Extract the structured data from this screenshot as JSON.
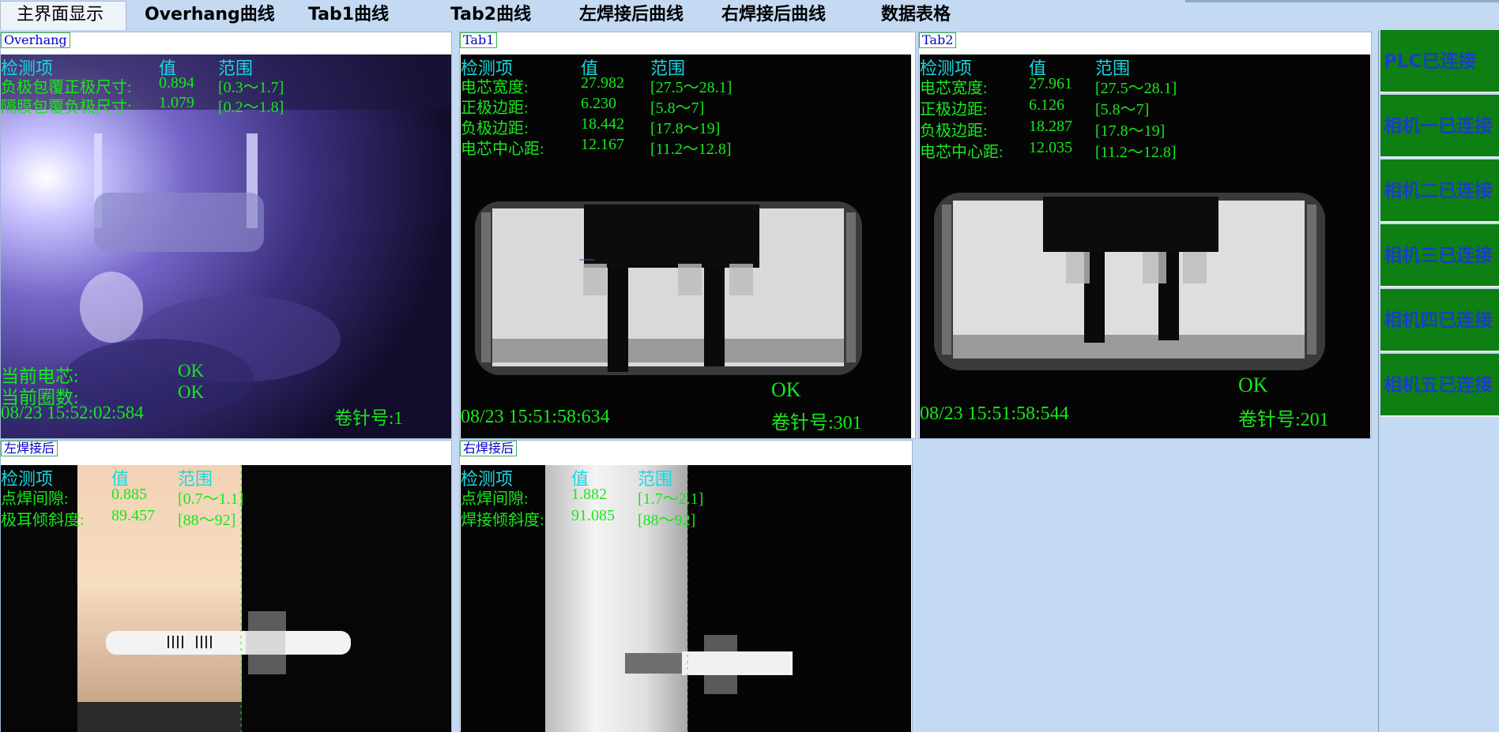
{
  "tabs": [
    {
      "label": "主界面显示"
    },
    {
      "label": "Overhang曲线"
    },
    {
      "label": "Tab1曲线"
    },
    {
      "label": "Tab2曲线"
    },
    {
      "label": "左焊接后曲线"
    },
    {
      "label": "右焊接后曲线"
    },
    {
      "label": "数据表格"
    }
  ],
  "panels": {
    "overhang": {
      "label": "Overhang",
      "header": {
        "item": "检测项",
        "value": "值",
        "range": "范围"
      },
      "rows": [
        {
          "name": "负极包覆正极尺寸:",
          "value": "0.894",
          "range": "[0.3～1.7]"
        },
        {
          "name": "隔膜包覆负极尺寸:",
          "value": "1.079",
          "range": "[0.2～1.8]"
        }
      ],
      "current_cell_label": "当前电芯:",
      "current_cell_value": "OK",
      "current_turns_label": "当前圈数:",
      "current_turns_value": "OK",
      "timestamp": "08/23 15:52:02:584",
      "pin": "卷针号:1"
    },
    "tab1": {
      "label": "Tab1",
      "header": {
        "item": "检测项",
        "value": "值",
        "range": "范围"
      },
      "rows": [
        {
          "name": "电芯宽度:",
          "value": "27.982",
          "range": "[27.5～28.1]"
        },
        {
          "name": "正极边距:",
          "value": "6.230",
          "range": "[5.8～7]"
        },
        {
          "name": "负极边距:",
          "value": "18.442",
          "range": "[17.8～19]"
        },
        {
          "name": "电芯中心距:",
          "value": "12.167",
          "range": "[11.2～12.8]"
        }
      ],
      "result": "OK",
      "timestamp": "08/23 15:51:58:634",
      "pin": "卷针号:301"
    },
    "tab2": {
      "label": "Tab2",
      "header": {
        "item": "检测项",
        "value": "值",
        "range": "范围"
      },
      "rows": [
        {
          "name": "电芯宽度:",
          "value": "27.961",
          "range": "[27.5～28.1]"
        },
        {
          "name": "正极边距:",
          "value": "6.126",
          "range": "[5.8～7]"
        },
        {
          "name": "负极边距:",
          "value": "18.287",
          "range": "[17.8～19]"
        },
        {
          "name": "电芯中心距:",
          "value": "12.035",
          "range": "[11.2～12.8]"
        }
      ],
      "result": "OK",
      "timestamp": "08/23 15:51:58:544",
      "pin": "卷针号:201"
    },
    "left_weld": {
      "label": "左焊接后",
      "header": {
        "item": "检测项",
        "value": "值",
        "range": "范围"
      },
      "rows": [
        {
          "name": "点焊间隙:",
          "value": "0.885",
          "range": "[0.7～1.1]"
        },
        {
          "name": "极耳倾斜度:",
          "value": "89.457",
          "range": "[88～92]"
        }
      ]
    },
    "right_weld": {
      "label": "右焊接后",
      "header": {
        "item": "检测项",
        "value": "值",
        "range": "范围"
      },
      "rows": [
        {
          "name": "点焊间隙:",
          "value": "1.882",
          "range": "[1.7～2.1]"
        },
        {
          "name": "焊接倾斜度:",
          "value": "91.085",
          "range": "[88～92]"
        }
      ]
    }
  },
  "status": [
    {
      "label": "PLC已连接"
    },
    {
      "label": "相机一已连接"
    },
    {
      "label": "相机二已连接"
    },
    {
      "label": "相机三已连接"
    },
    {
      "label": "相机四已连接"
    },
    {
      "label": "相机五已连接"
    }
  ],
  "colors": {
    "background": "#c4d9f2",
    "overlay_text": "#17e81b",
    "header_text": "#18d8e0",
    "status_bg": "#0e7f12",
    "status_text": "#1b3ec8",
    "panel_label": "#0000c8"
  }
}
